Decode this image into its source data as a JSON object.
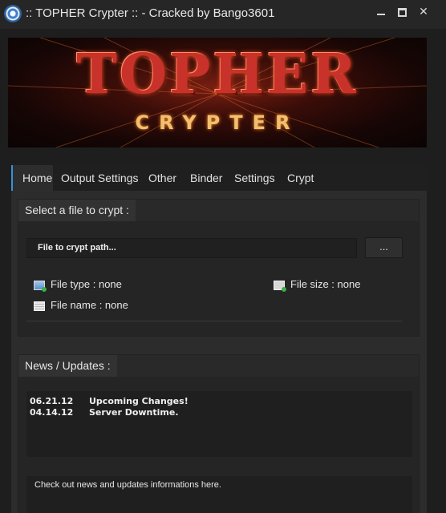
{
  "window": {
    "title": ":: TOPHER Crypter ::  - Cracked by Bango3601",
    "minimize_icon": "minimize-icon",
    "maximize_icon": "maximize-icon",
    "close_label": "✕"
  },
  "banner": {
    "line1": "TOPHER",
    "line2": "CRYPTER"
  },
  "tabs": [
    {
      "label": "Home",
      "active": true
    },
    {
      "label": "Output Settings"
    },
    {
      "label": "Other"
    },
    {
      "label": "Binder"
    },
    {
      "label": "Settings"
    },
    {
      "label": "Crypt"
    }
  ],
  "file_group": {
    "header": "Select a file to crypt :",
    "path_placeholder": "File to crypt path...",
    "browse_label": "...",
    "file_type": "File type : none",
    "file_size": "File size :  none",
    "file_name": "File name :  none"
  },
  "news_group": {
    "header": "News / Updates :",
    "items": [
      {
        "date": "06.21.12",
        "text": "Upcoming Changes!"
      },
      {
        "date": "04.14.12",
        "text": "Server Downtime."
      }
    ],
    "description": "Check out news and updates informations here."
  },
  "colors": {
    "background": "#1e1e1e",
    "panel": "#2c2c2c",
    "accent": "#3a8fd8",
    "logo_red": "#c8322a",
    "logo_gold": "#f0c070"
  }
}
